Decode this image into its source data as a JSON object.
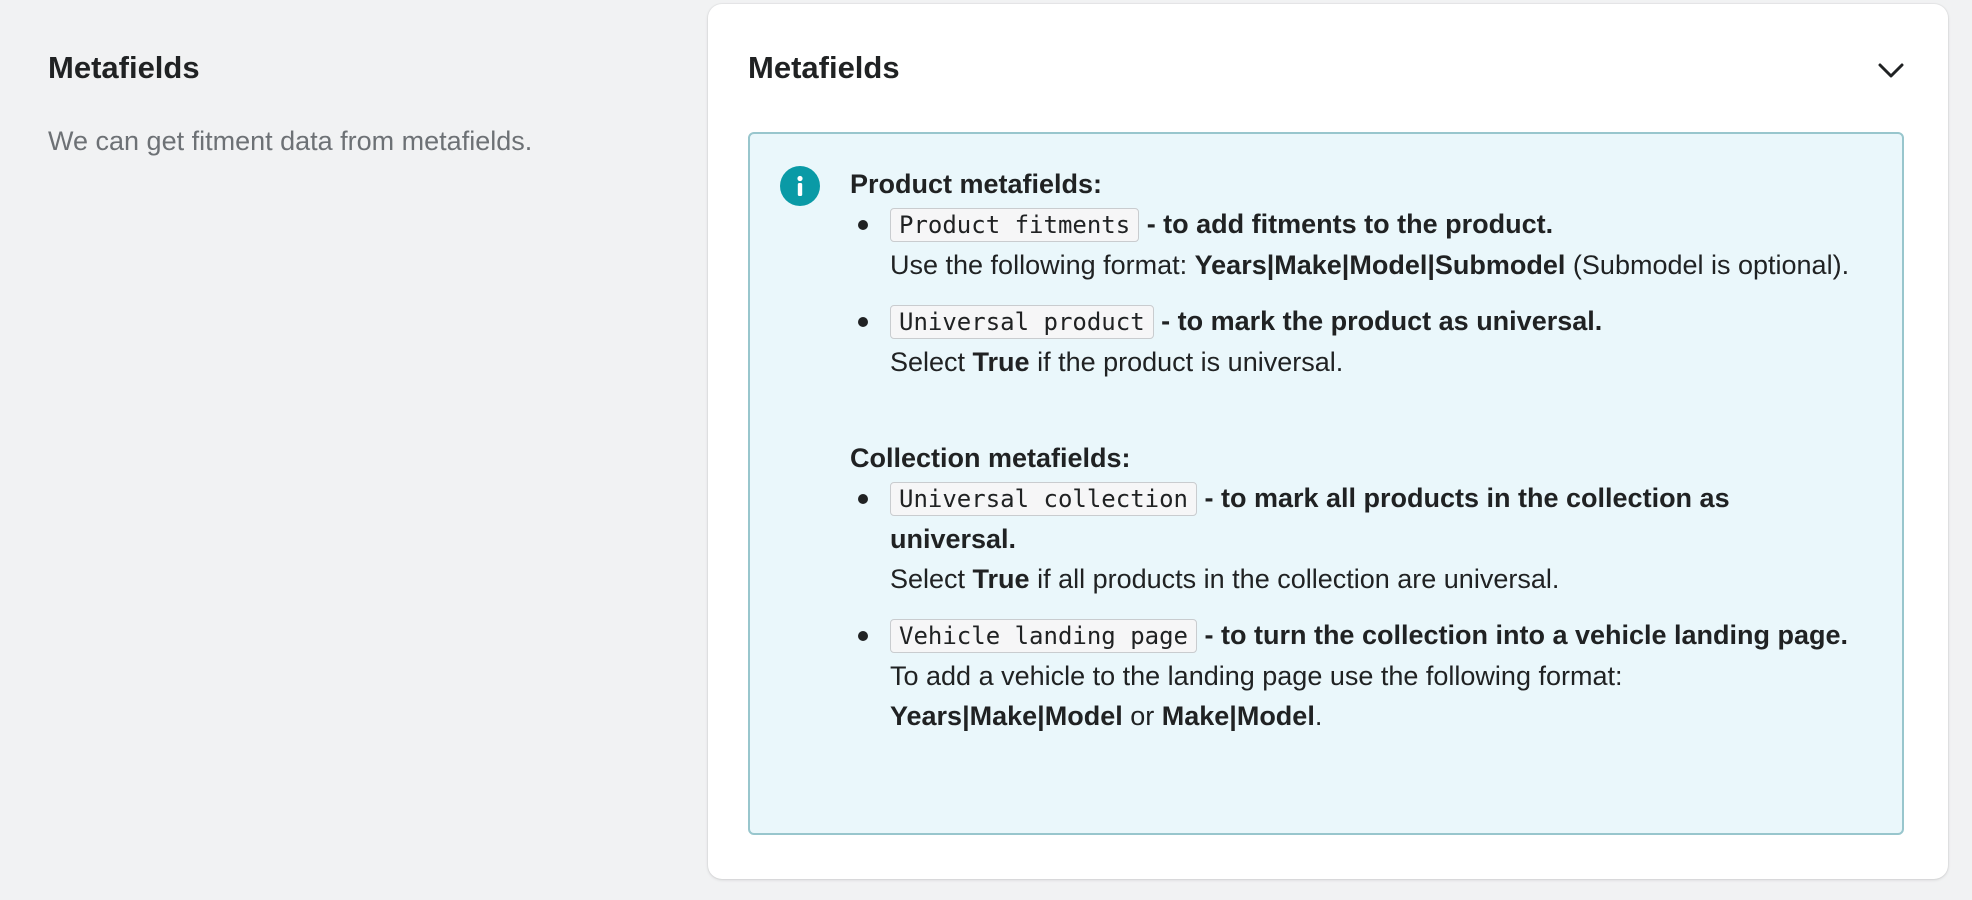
{
  "section": {
    "title": "Metafields",
    "description": "We can get fitment data from metafields."
  },
  "card": {
    "title": "Metafields",
    "collapse_icon": "chevron-down-icon"
  },
  "banner": {
    "icon": "info-icon",
    "product_group": {
      "title": "Product metafields:",
      "items": [
        {
          "key": "Product fitments",
          "summary": " - to add fitments to the product.",
          "desc_before": "Use the following format: ",
          "desc_bold": "Years|Make|Model|Submodel",
          "desc_after": " (Submodel is optional)."
        },
        {
          "key": "Universal product",
          "summary": " - to mark the product as universal.",
          "desc_before": "Select ",
          "desc_bold": "True",
          "desc_after": " if the product is universal."
        }
      ]
    },
    "collection_group": {
      "title": "Collection metafields:",
      "items": [
        {
          "key": "Universal collection",
          "summary": " - to mark all products in the collection as universal.",
          "desc_before": "Select ",
          "desc_bold": "True",
          "desc_after": " if all products in the collection are universal."
        },
        {
          "key": "Vehicle landing page",
          "summary": " - to turn the collection into a vehicle landing page.",
          "desc_before": "To add a vehicle to the landing page use the following format: ",
          "desc_bold": "Years|Make|Model",
          "desc_middle": " or ",
          "desc_bold2": "Make|Model",
          "desc_after": "."
        }
      ]
    }
  }
}
